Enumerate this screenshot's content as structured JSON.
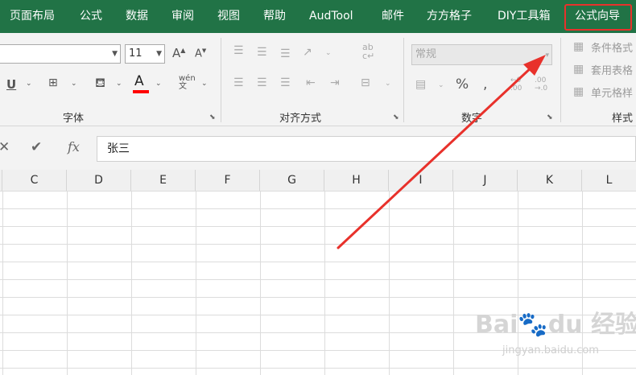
{
  "menu_tabs": [
    "页面布局",
    "公式",
    "数据",
    "审阅",
    "视图",
    "帮助",
    "AudTool",
    "邮件",
    "方方格子",
    "DIY工具箱",
    "公式向导"
  ],
  "font": {
    "name": "",
    "size": "11",
    "group_label": "字体"
  },
  "alignment": {
    "group_label": "对齐方式"
  },
  "number": {
    "format": "常规",
    "group_label": "数字",
    "percent_symbol": "%"
  },
  "styles": {
    "conditional_format": "条件格式",
    "table_format": "套用表格",
    "cell_styles": "单元格样",
    "group_label": "样式"
  },
  "formula_bar": {
    "value": "张三",
    "fx_label": "fx"
  },
  "columns": [
    "C",
    "D",
    "E",
    "F",
    "G",
    "H",
    "I",
    "J",
    "K",
    "L"
  ],
  "watermark": {
    "brand": "Bai",
    "brand2": "du",
    "word": "经验",
    "url": "jingyan.baidu.com"
  },
  "annotation": {
    "highlight_color": "#e8312b",
    "arrow_color": "#e8312b"
  },
  "colors": {
    "ribbon_green": "#217346",
    "font_color_bar": "#ff0000"
  }
}
